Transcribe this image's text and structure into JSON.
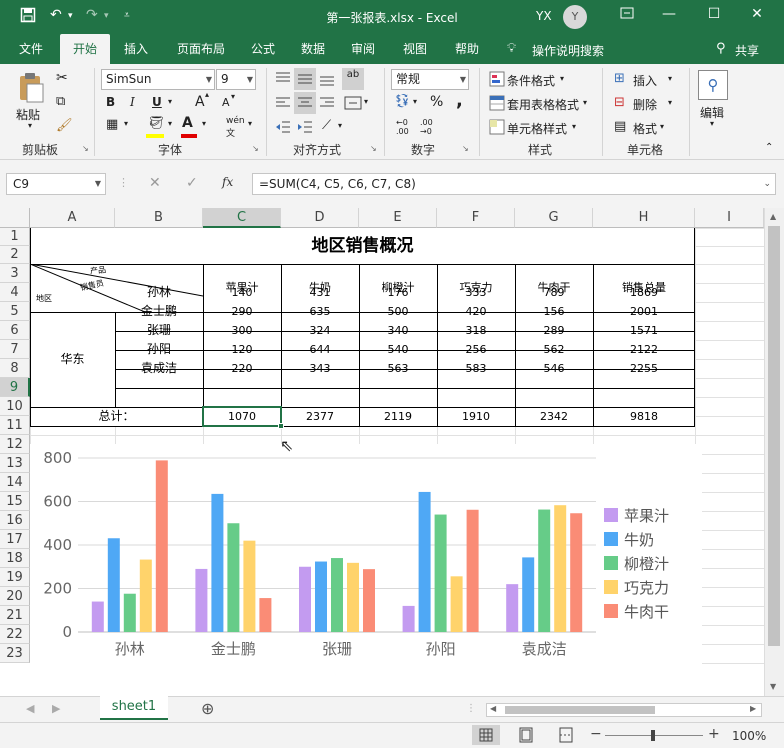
{
  "window": {
    "title": "第一张报表.xlsx - Excel",
    "user_initials": "YX",
    "avatar_letter": "Y"
  },
  "menu": {
    "tabs": [
      "文件",
      "开始",
      "插入",
      "页面布局",
      "公式",
      "数据",
      "审阅",
      "视图",
      "帮助"
    ],
    "active": "开始",
    "tell_me": "操作说明搜索",
    "share": "共享"
  },
  "ribbon": {
    "clipboard": {
      "label": "剪贴板",
      "paste": "粘贴"
    },
    "font": {
      "label": "字体",
      "name": "SimSun",
      "size": "9",
      "bold": "B",
      "italic": "I",
      "underline": "U",
      "grow": "A",
      "shrink": "A",
      "color_letter": "A",
      "phonetic": "wén"
    },
    "alignment": {
      "label": "对齐方式",
      "wrap": "ab"
    },
    "number": {
      "label": "数字",
      "format": "常规",
      "percent": "%",
      "comma": ","
    },
    "styles": {
      "label": "样式",
      "conditional": "条件格式",
      "table": "套用表格格式",
      "cell": "单元格样式"
    },
    "cells": {
      "label": "单元格",
      "insert": "插入",
      "delete": "删除",
      "format": "格式"
    },
    "editing": {
      "label": "编辑"
    }
  },
  "formula_bar": {
    "name_box": "C9",
    "formula": "=SUM(C4, C5, C6, C7, C8)",
    "fx": "fx"
  },
  "columns": [
    "A",
    "B",
    "C",
    "D",
    "E",
    "F",
    "G",
    "H",
    "I"
  ],
  "rows": [
    "1",
    "2",
    "3",
    "4",
    "5",
    "6",
    "7",
    "8",
    "9",
    "10",
    "11",
    "12",
    "13",
    "14",
    "15",
    "16",
    "17",
    "18",
    "19",
    "20",
    "21",
    "22",
    "23"
  ],
  "sheet": {
    "title": "地区销售概况",
    "diag": {
      "top": "产品",
      "mid": "销售员",
      "bottom": "地区"
    },
    "headers": [
      "苹果汁",
      "牛奶",
      "柳橙汁",
      "巧克力",
      "牛肉干",
      "销售总量"
    ],
    "region": "华东",
    "rows": [
      {
        "name": "孙林",
        "values": [
          "140",
          "431",
          "176",
          "333",
          "789",
          "1869"
        ]
      },
      {
        "name": "金士鹏",
        "values": [
          "290",
          "635",
          "500",
          "420",
          "156",
          "2001"
        ]
      },
      {
        "name": "张珊",
        "values": [
          "300",
          "324",
          "340",
          "318",
          "289",
          "1571"
        ]
      },
      {
        "name": "孙阳",
        "values": [
          "120",
          "644",
          "540",
          "256",
          "562",
          "2122"
        ]
      },
      {
        "name": "袁成洁",
        "values": [
          "220",
          "343",
          "563",
          "583",
          "546",
          "2255"
        ]
      }
    ],
    "total_label": "总计：",
    "totals": [
      "1070",
      "2377",
      "2119",
      "1910",
      "2342",
      "9818"
    ]
  },
  "chart_data": {
    "type": "bar",
    "categories": [
      "孙林",
      "金士鹏",
      "张珊",
      "孙阳",
      "袁成洁"
    ],
    "series": [
      {
        "name": "苹果汁",
        "color": "#c39bf0",
        "values": [
          140,
          290,
          300,
          120,
          220
        ]
      },
      {
        "name": "牛奶",
        "color": "#4fa8f5",
        "values": [
          431,
          635,
          324,
          644,
          343
        ]
      },
      {
        "name": "柳橙汁",
        "color": "#66cc88",
        "values": [
          176,
          500,
          340,
          540,
          563
        ]
      },
      {
        "name": "巧克力",
        "color": "#ffd36b",
        "values": [
          333,
          420,
          318,
          256,
          583
        ]
      },
      {
        "name": "牛肉干",
        "color": "#fa8c76",
        "values": [
          789,
          156,
          289,
          562,
          546
        ]
      }
    ],
    "yticks": [
      "0",
      "200",
      "400",
      "600",
      "800"
    ],
    "ylim": [
      0,
      800
    ],
    "grid": true,
    "legend": "right"
  },
  "sheet_tabs": {
    "active": "sheet1"
  },
  "status": {
    "zoom": "100%"
  },
  "colors": {
    "accent": "#217346"
  }
}
